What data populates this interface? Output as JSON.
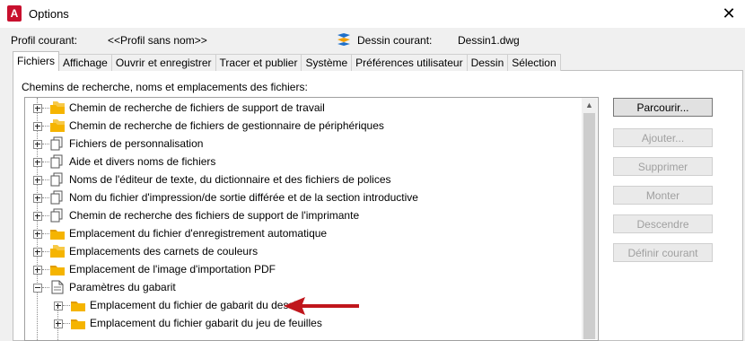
{
  "window": {
    "title": "Options",
    "close_glyph": "✕",
    "app_icon_letter": "A"
  },
  "header": {
    "profile_label": "Profil courant:",
    "profile_value": "<<Profil sans nom>>",
    "drawing_label": "Dessin courant:",
    "drawing_value": "Dessin1.dwg"
  },
  "tabs": [
    "Fichiers",
    "Affichage",
    "Ouvrir et enregistrer",
    "Tracer et publier",
    "Système",
    "Préférences utilisateur",
    "Dessin",
    "Sélection"
  ],
  "active_tab": "Fichiers",
  "section_label": "Chemins de recherche, noms et emplacements des fichiers:",
  "tree_items": [
    {
      "label": "Chemin de recherche de fichiers de support de travail",
      "icon": "folder-stack-icon",
      "level": 0,
      "expander": "plus"
    },
    {
      "label": "Chemin de recherche de fichiers de gestionnaire de périphériques",
      "icon": "folder-stack-icon",
      "level": 0,
      "expander": "plus"
    },
    {
      "label": "Fichiers de personnalisation",
      "icon": "files-icon",
      "level": 0,
      "expander": "plus"
    },
    {
      "label": "Aide et divers noms de fichiers",
      "icon": "files-icon",
      "level": 0,
      "expander": "plus"
    },
    {
      "label": "Noms de l'éditeur de texte, du dictionnaire et des fichiers de polices",
      "icon": "files-icon",
      "level": 0,
      "expander": "plus"
    },
    {
      "label": "Nom du fichier d'impression/de sortie différée et de la section introductive",
      "icon": "files-icon",
      "level": 0,
      "expander": "plus"
    },
    {
      "label": "Chemin de recherche des fichiers de support de l'imprimante",
      "icon": "files-icon",
      "level": 0,
      "expander": "plus"
    },
    {
      "label": "Emplacement du fichier d'enregistrement automatique",
      "icon": "folder-icon",
      "level": 0,
      "expander": "plus"
    },
    {
      "label": "Emplacements des carnets de couleurs",
      "icon": "folder-stack-icon",
      "level": 0,
      "expander": "plus"
    },
    {
      "label": "Emplacement de l'image d'importation PDF",
      "icon": "folder-icon",
      "level": 0,
      "expander": "plus"
    },
    {
      "label": "Paramètres du gabarit",
      "icon": "document-icon",
      "level": 0,
      "expander": "minus"
    },
    {
      "label": "Emplacement du fichier de gabarit du dessin",
      "icon": "folder-icon",
      "level": 1,
      "expander": "plus"
    },
    {
      "label": "Emplacement du fichier gabarit du jeu de feuilles",
      "icon": "folder-icon",
      "level": 1,
      "expander": "plus"
    }
  ],
  "buttons": [
    {
      "label": "Parcourir...",
      "enabled": true
    },
    {
      "label": "Ajouter...",
      "enabled": false
    },
    {
      "label": "Supprimer",
      "enabled": false
    },
    {
      "label": "Monter",
      "enabled": false
    },
    {
      "label": "Descendre",
      "enabled": false
    },
    {
      "label": "Définir courant",
      "enabled": false
    }
  ],
  "colors": {
    "accent_red": "#c8102e",
    "folder_yellow": "#f5b400",
    "annotation_arrow": "#c0161c"
  }
}
